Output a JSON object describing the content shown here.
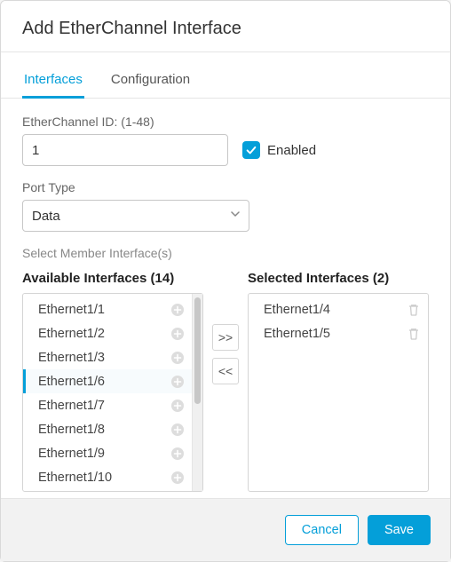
{
  "dialog": {
    "title": "Add EtherChannel Interface"
  },
  "tabs": {
    "interfaces": "Interfaces",
    "configuration": "Configuration"
  },
  "fields": {
    "etherchannel_id_label": "EtherChannel ID: (1-48)",
    "etherchannel_id_value": "1",
    "enabled_label": "Enabled",
    "port_type_label": "Port Type",
    "port_type_value": "Data",
    "member_label": "Select Member Interface(s)"
  },
  "lists": {
    "available_header": "Available Interfaces (14)",
    "selected_header": "Selected Interfaces (2)",
    "available": [
      {
        "label": "Ethernet1/1",
        "selected": false
      },
      {
        "label": "Ethernet1/2",
        "selected": false
      },
      {
        "label": "Ethernet1/3",
        "selected": false
      },
      {
        "label": "Ethernet1/6",
        "selected": true
      },
      {
        "label": "Ethernet1/7",
        "selected": false
      },
      {
        "label": "Ethernet1/8",
        "selected": false
      },
      {
        "label": "Ethernet1/9",
        "selected": false
      },
      {
        "label": "Ethernet1/10",
        "selected": false
      }
    ],
    "selected": [
      {
        "label": "Ethernet1/4"
      },
      {
        "label": "Ethernet1/5"
      }
    ]
  },
  "buttons": {
    "move_right": ">>",
    "move_left": "<<",
    "cancel": "Cancel",
    "save": "Save"
  }
}
